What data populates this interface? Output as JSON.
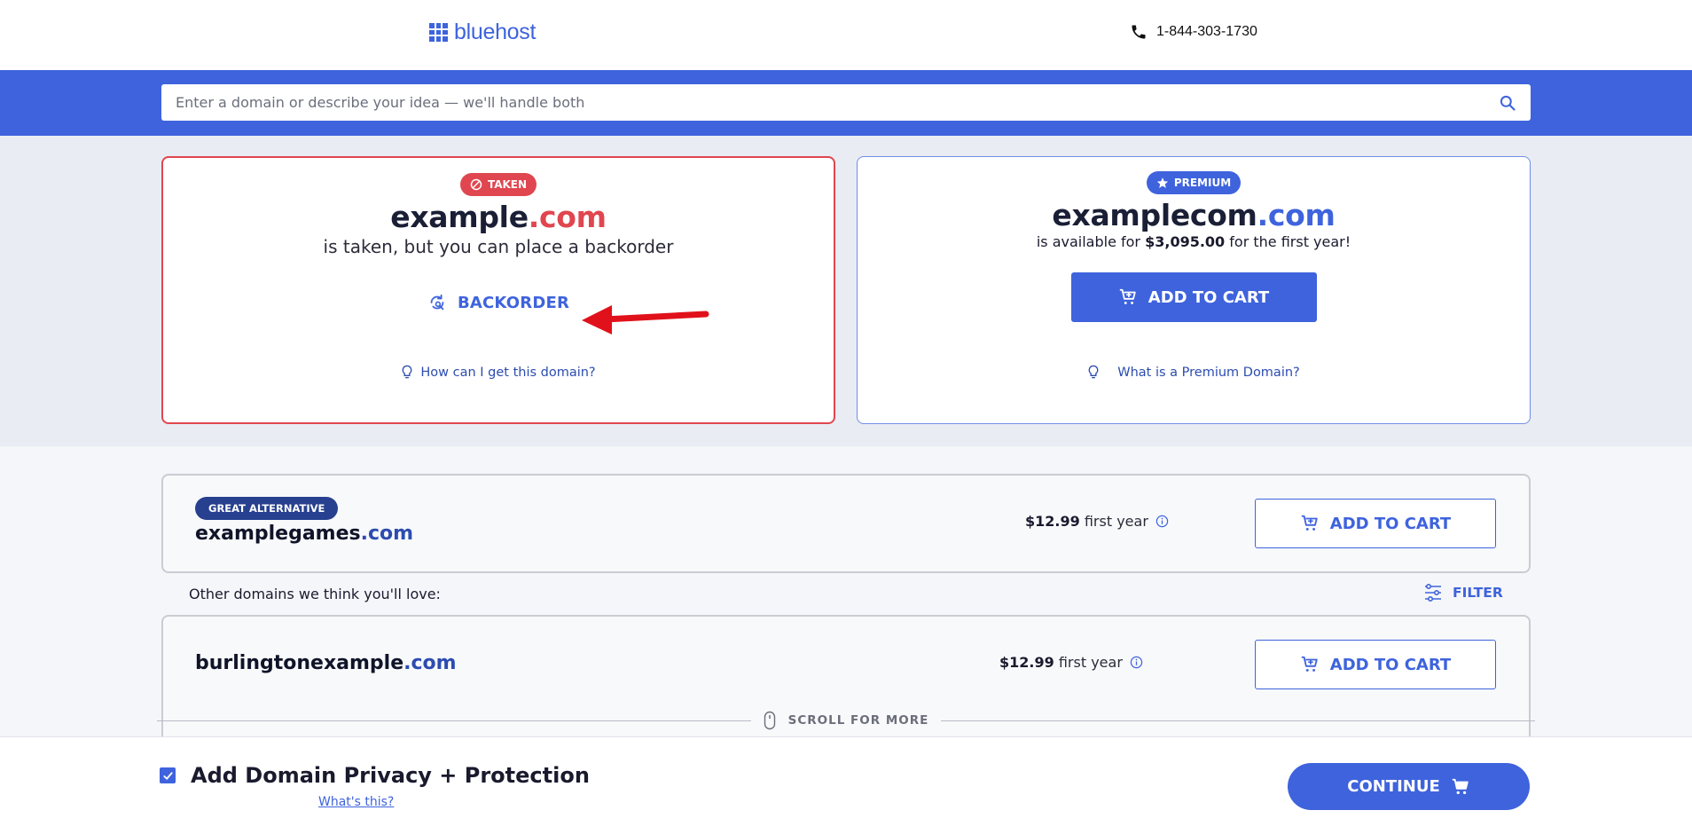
{
  "header": {
    "logo_text": "bluehost",
    "phone": "1-844-303-1730"
  },
  "search": {
    "placeholder": "Enter a domain or describe your idea — we'll handle both"
  },
  "taken_card": {
    "badge": "TAKEN",
    "domain_name": "example",
    "domain_tld": ".com",
    "subtitle": "is taken, but you can place a backorder",
    "backorder_label": "BACKORDER",
    "help_link": "How can I get this domain?"
  },
  "premium_card": {
    "badge": "PREMIUM",
    "domain_name": "examplecom",
    "domain_tld": ".com",
    "subtitle_prefix": "is available for ",
    "price": "$3,095.00",
    "subtitle_suffix": " for the first year!",
    "add_to_cart_label": "ADD TO CART",
    "help_link": "What is a Premium Domain?"
  },
  "alternative": {
    "badge": "GREAT ALTERNATIVE",
    "domain_name": "examplegames",
    "domain_tld": ".com",
    "price": "$12.99",
    "price_suffix": "first year",
    "add_to_cart_label": "ADD TO CART"
  },
  "suggestions": {
    "label": "Other domains we think you'll love:",
    "filter_label": "FILTER",
    "items": [
      {
        "domain_name": "burlingtonexample",
        "domain_tld": ".com",
        "price": "$12.99",
        "price_suffix": "first year",
        "add_to_cart_label": "ADD TO CART"
      }
    ],
    "scroll_hint": "SCROLL FOR MORE"
  },
  "footer": {
    "privacy_checked": true,
    "privacy_label": "Add Domain Privacy + Protection",
    "whats_this": "What's this?",
    "continue_label": "CONTINUE"
  },
  "colors": {
    "brand_blue": "#3e63dd",
    "taken_red": "#e0464f",
    "dark_badge": "#27408f",
    "arrow_red": "#e0111a"
  },
  "icons": [
    "phone-icon",
    "search-icon",
    "ban-icon",
    "star-icon",
    "backorder-icon",
    "lightbulb-icon",
    "cart-icon",
    "info-icon",
    "filter-icon",
    "mouse-icon",
    "checkmark-icon"
  ]
}
